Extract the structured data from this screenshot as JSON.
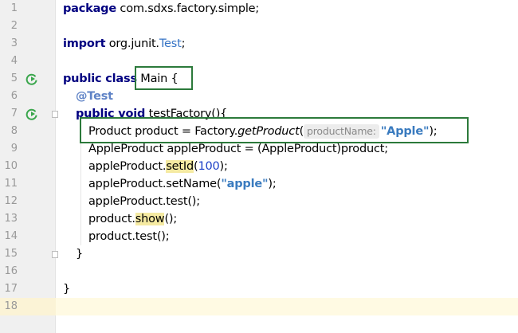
{
  "editor": {
    "lines": [
      {
        "n": "1"
      },
      {
        "n": "2"
      },
      {
        "n": "3"
      },
      {
        "n": "4"
      },
      {
        "n": "5"
      },
      {
        "n": "6"
      },
      {
        "n": "7"
      },
      {
        "n": "8"
      },
      {
        "n": "9"
      },
      {
        "n": "10"
      },
      {
        "n": "11"
      },
      {
        "n": "12"
      },
      {
        "n": "13"
      },
      {
        "n": "14"
      },
      {
        "n": "15"
      },
      {
        "n": "16"
      },
      {
        "n": "17"
      },
      {
        "n": "18"
      }
    ],
    "code": {
      "l1_kw": "package",
      "l1_rest": " com.sdxs.factory.simple;",
      "l3_kw": "import",
      "l3_pkg": " org.junit.",
      "l3_cls": "Test",
      "l3_end": ";",
      "l5_kw": "public class",
      "l5_name": " Main {",
      "l6_ann": "@Test",
      "l7_kw": "public void",
      "l7_rest": " testFactory(){",
      "l8_a": "Product product = Factory.",
      "l8_method": "getProduct",
      "l8_paren": "(",
      "l8_hint": "productName:",
      "l8_str": "\"Apple\"",
      "l8_end": ");",
      "l9": "AppleProduct appleProduct = (AppleProduct)product;",
      "l10_a": "appleProduct.",
      "l10_hl": "setId",
      "l10_b": "(",
      "l10_num": "100",
      "l10_c": ");",
      "l11_a": "appleProduct.setName(",
      "l11_str": "\"apple\"",
      "l11_b": ");",
      "l12": "appleProduct.test();",
      "l13_a": "product.",
      "l13_hl": "show",
      "l13_b": "();",
      "l14": "product.test();",
      "l15": "}",
      "l17": "}"
    }
  },
  "colors": {
    "keyword": "#000080",
    "annotation": "#5f83c6",
    "string": "#3a7bbf",
    "highlight": "#f5eaa2",
    "box": "#2c7a3b",
    "run_icon": "#3aa64c"
  },
  "icons": [
    "run-class-icon",
    "run-test-icon",
    "fold-icon"
  ]
}
